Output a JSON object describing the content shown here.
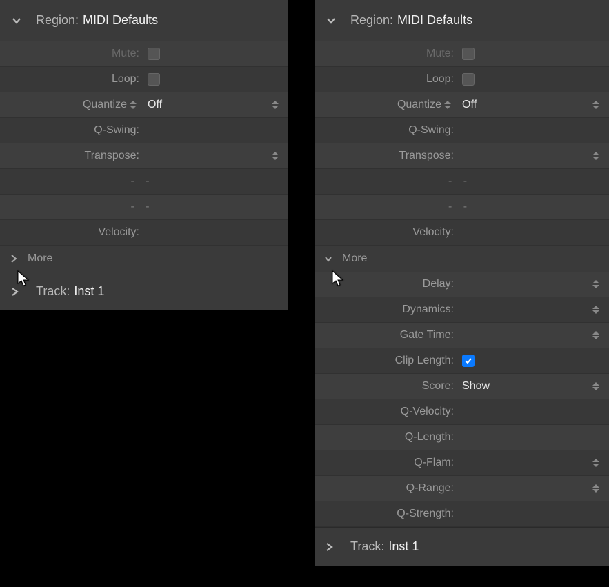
{
  "left": {
    "region_label": "Region:",
    "region_value": "MIDI Defaults",
    "mute_label": "Mute:",
    "loop_label": "Loop:",
    "quantize_label": "Quantize",
    "quantize_value": "Off",
    "qswing_label": "Q-Swing:",
    "transpose_label": "Transpose:",
    "dash1": "-  -",
    "dash2": "-  -",
    "velocity_label": "Velocity:",
    "more_label": "More",
    "track_label": "Track:",
    "track_value": "Inst 1"
  },
  "right": {
    "region_label": "Region:",
    "region_value": "MIDI Defaults",
    "mute_label": "Mute:",
    "loop_label": "Loop:",
    "quantize_label": "Quantize",
    "quantize_value": "Off",
    "qswing_label": "Q-Swing:",
    "transpose_label": "Transpose:",
    "dash1": "-  -",
    "dash2": "-  -",
    "velocity_label": "Velocity:",
    "more_label": "More",
    "delay_label": "Delay:",
    "dynamics_label": "Dynamics:",
    "gatetime_label": "Gate Time:",
    "cliplength_label": "Clip Length:",
    "cliplength_checked": true,
    "score_label": "Score:",
    "score_value": "Show",
    "qvelocity_label": "Q-Velocity:",
    "qlength_label": "Q-Length:",
    "qflam_label": "Q-Flam:",
    "qrange_label": "Q-Range:",
    "qstrength_label": "Q-Strength:",
    "track_label": "Track:",
    "track_value": "Inst 1"
  }
}
